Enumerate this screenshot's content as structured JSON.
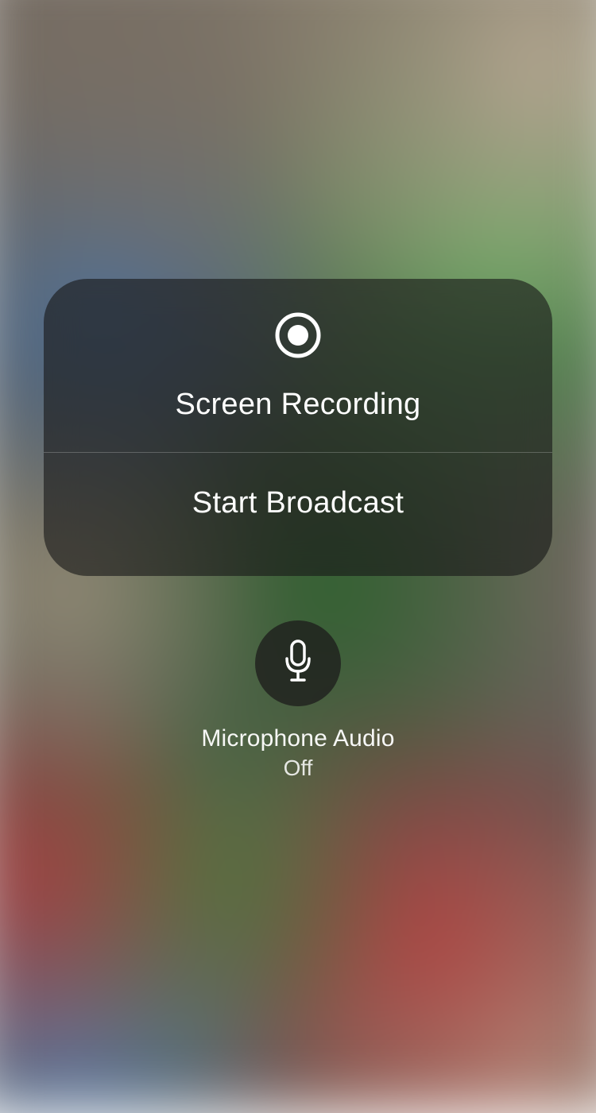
{
  "panel": {
    "title": "Screen Recording",
    "action_label": "Start Broadcast"
  },
  "microphone": {
    "label": "Microphone Audio",
    "status": "Off"
  }
}
